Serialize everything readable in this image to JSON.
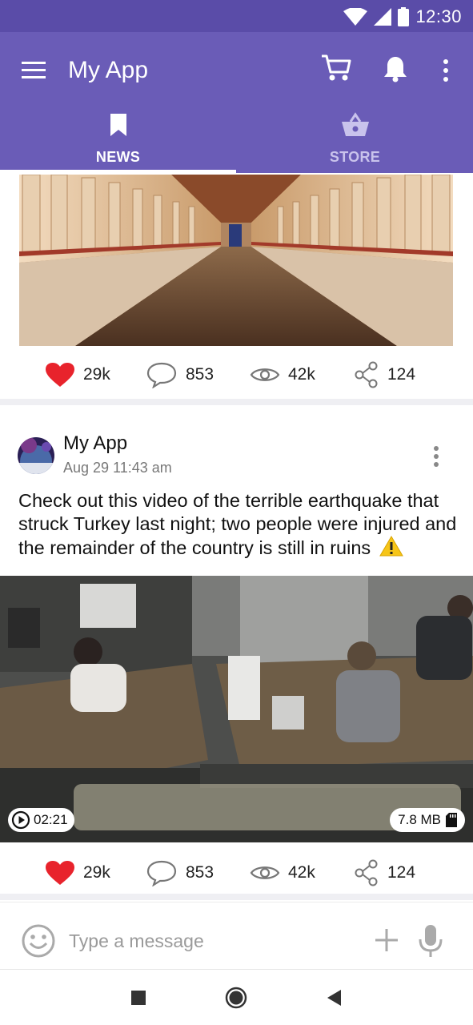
{
  "status_bar": {
    "time": "12:30",
    "icons": [
      "wifi-icon",
      "signal-icon",
      "battery-icon"
    ]
  },
  "app_bar": {
    "title": "My App",
    "actions": [
      "menu-icon",
      "cart-icon",
      "bell-icon",
      "more-vert-icon"
    ],
    "color": "#6a5cb7"
  },
  "tabs": [
    {
      "label": "NEWS",
      "icon": "bookmark-icon",
      "selected": true
    },
    {
      "label": "STORE",
      "icon": "basket-icon",
      "selected": false
    }
  ],
  "feed": {
    "post_top": {
      "image": "temple-corridor-photo",
      "stats": {
        "likes": "29k",
        "comments": "853",
        "views": "42k",
        "shares": "124"
      }
    },
    "post_video": {
      "author": "My App",
      "time": "Aug 29 11:43 am",
      "text": "Check out this video of the terrible earthquake that struck Turkey last night; two people were injured and the remainder of the country is still in ruins",
      "warning_icon": "warning-icon",
      "video": {
        "duration": "02:21",
        "size": "7.8 MB"
      },
      "stats": {
        "likes": "29k",
        "comments": "853",
        "views": "42k",
        "shares": "124"
      }
    }
  },
  "composer": {
    "placeholder": "Type a message"
  },
  "nav_bar": {
    "buttons": [
      "recents-button",
      "home-button",
      "back-button"
    ]
  },
  "colors": {
    "primary": "#6a5cb7",
    "primary_dark": "#5a4ca8",
    "like": "#e8232c"
  }
}
